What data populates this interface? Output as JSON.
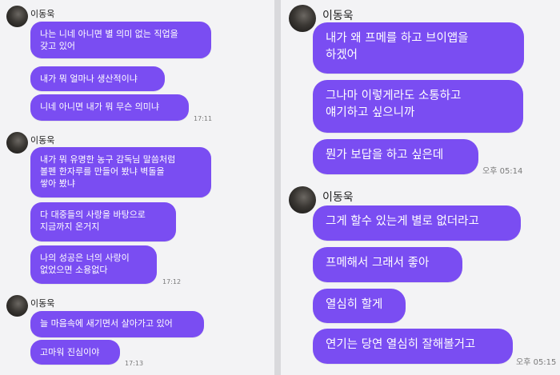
{
  "left_panel": {
    "groups": [
      {
        "sender": "이동욱",
        "messages": [
          "나는 니네 아니면 별 의미 없는 직업을\n갖고 있어",
          "내가 뭐 얼마나 생산적이냐",
          "니네 아니면 내가 뭐 무슨 의미냐"
        ],
        "time": "17:11"
      },
      {
        "sender": "이동욱",
        "messages": [
          "내가 뭐 유명한 농구 감독님 말씀처럼\n볼펜 한자루를 만들어 봤냐 벽돌을\n쌓아 봤냐",
          "다 대중들의 사랑을 바탕으로\n지금까지 온거지",
          "나의 성공은 너의 사랑이\n없었으면 소용없다"
        ],
        "time": "17:12"
      },
      {
        "sender": "이동욱",
        "messages": [
          "늘 마음속에 새기면서 살아가고 있어",
          "고마워 진심이야"
        ],
        "time": "17:13"
      }
    ]
  },
  "right_panel": {
    "groups": [
      {
        "sender": "이동욱",
        "messages": [
          "내가 왜 프메를 하고 브이앱을\n하겠어",
          "그나마 이렇게라도 소통하고\n얘기하고 싶으니까",
          "뭔가 보답을 하고 싶은데"
        ],
        "time": "오후 05:14"
      },
      {
        "sender": "이동욱",
        "messages": [
          "그게 할수 있는게 별로 없더라고",
          "프메해서 그래서 좋아",
          "열심히 할게",
          "연기는 당연 열심히 잘해볼거고"
        ],
        "time": "오후 05:15"
      }
    ]
  },
  "colors": {
    "bubble": "#7a4df2",
    "background": "#f3f3f5",
    "divider": "#d9d9dc"
  },
  "icons": {
    "avatar": "profile-photo-icon"
  }
}
